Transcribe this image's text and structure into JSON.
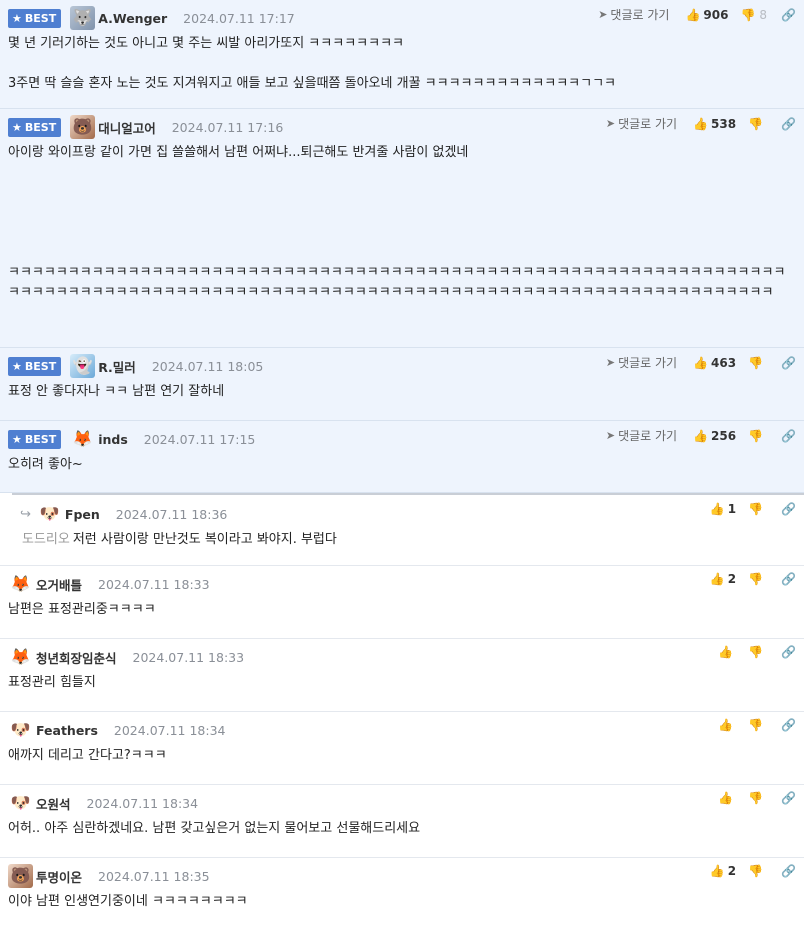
{
  "labels": {
    "best": "BEST",
    "reply": "댓글로 가기"
  },
  "best_comments": [
    {
      "nick": "A.Wenger",
      "date": "2024.07.11 17:17",
      "up": "906",
      "down": "8",
      "lines": [
        "몇 년 기러기하는 것도 아니고 몇 주는 씨발 아리가또지 ㅋㅋㅋㅋㅋㅋㅋㅋ",
        "",
        "3주면 딱 슬슬 혼자 노는 것도 지겨워지고 애들 보고 싶을때쯤 돌아오네 개꿀 ㅋㅋㅋㅋㅋㅋㅋㅋㅋㅋㅋㅋㅋㄱㄱㅋ"
      ]
    },
    {
      "nick": "대니얼고어",
      "date": "2024.07.11 17:16",
      "up": "538",
      "down": "",
      "lines": [
        "아이랑 와이프랑 같이 가면 집 쓸쓸해서 남편 어쩌냐...퇴근해도 반겨줄 사람이 없겠네",
        "ㅋㅋㅋㅋㅋㅋㅋㅋㅋㅋㅋㅋㅋㅋㅋㅋㅋㅋㅋㅋㅋㅋㅋㅋㅋㅋㅋㅋㅋㅋㅋㅋㅋㅋㅋㅋㅋㅋㅋㅋㅋㅋㅋㅋㅋㅋㅋㅋㅋㅋㅋㅋㅋㅋㅋㅋㅋㅋㅋㅋㅋㅋㅋㅋㅋㅋㅋㅋㅋㅋㅋㅋㅋㅋㅋㅋㅋㅋㅋㅋㅋㅋㅋㅋㅋㅋㅋㅋㅋㅋㅋㅋㅋㅋㅋㅋㅋㅋㅋㅋㅋㅋㅋㅋㅋㅋㅋㅋㅋㅋㅋㅋㅋㅋㅋㅋㅋㅋㅋㅋㅋㅋㅋㅋㅋㅋㅋㅋㅋ"
      ]
    },
    {
      "nick": "R.밀러",
      "date": "2024.07.11 18:05",
      "up": "463",
      "down": "",
      "lines": [
        "표정 안 좋다자나 ㅋㅋ 남편 연기 잘하네"
      ]
    },
    {
      "nick": "inds",
      "date": "2024.07.11 17:15",
      "up": "256",
      "down": "",
      "lines": [
        "오히려 좋아~"
      ]
    }
  ],
  "reply": {
    "nick": "Fpen",
    "date": "2024.07.11 18:36",
    "up": "1",
    "mention": "도드리오",
    "text": "저런 사람이랑 만난것도 복이라고 봐야지. 부럽다"
  },
  "comments": [
    {
      "nick": "오거배틀",
      "date": "2024.07.11 18:33",
      "up": "2",
      "text": "남편은 표정관리중ㅋㅋㅋㅋ"
    },
    {
      "nick": "청년회장임춘식",
      "date": "2024.07.11 18:33",
      "up": "",
      "text": "표정관리 힘들지"
    },
    {
      "nick": "Feathers",
      "date": "2024.07.11 18:34",
      "up": "",
      "text": "애까지 데리고 간다고?ㅋㅋㅋ"
    },
    {
      "nick": "오원석",
      "date": "2024.07.11 18:34",
      "up": "",
      "text": "어허.. 아주 심란하겠네요. 남편 갖고싶은거 없는지 물어보고 선물해드리세요"
    },
    {
      "nick": "투명이온",
      "date": "2024.07.11 18:35",
      "up": "2",
      "text": "이야 남편 인생연기중이네 ㅋㅋㅋㅋㅋㅋㅋㅋ"
    }
  ]
}
